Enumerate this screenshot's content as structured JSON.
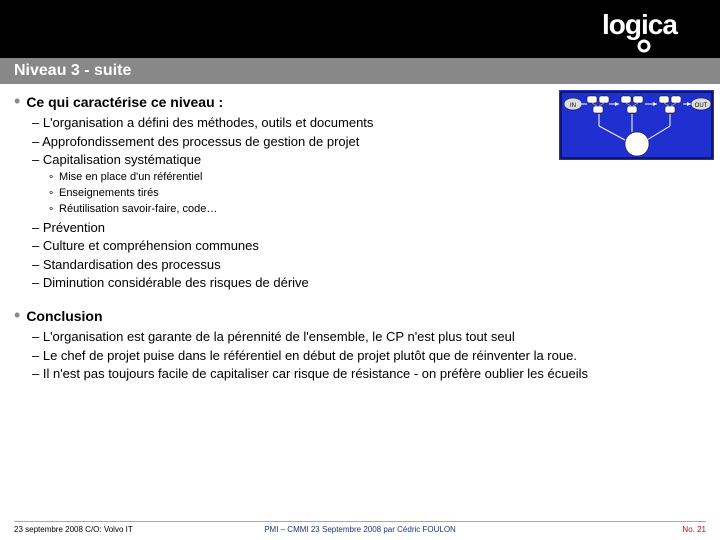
{
  "logo": {
    "name": "logica"
  },
  "title": "Niveau 3 - suite",
  "sections": [
    {
      "heading": "Ce qui caractérise ce niveau :",
      "items": [
        {
          "text": "L'organisation a défini des méthodes, outils et documents"
        },
        {
          "text": "Approfondissement des processus de gestion de projet"
        },
        {
          "text": "Capitalisation systématique",
          "sub": [
            "Mise en place d'un référentiel",
            "Enseignements tirés",
            "Réutilisation savoir-faire, code…"
          ]
        },
        {
          "text": "Prévention"
        },
        {
          "text": "Culture et compréhension communes"
        },
        {
          "text": "Standardisation des processus"
        },
        {
          "text": "Diminution considérable des risques de dérive"
        }
      ]
    },
    {
      "heading": "Conclusion",
      "items": [
        {
          "text": "L'organisation est garante de la pérennité de l'ensemble, le CP n'est plus tout seul"
        },
        {
          "text": "Le chef de projet puise dans le référentiel en début de projet plutôt que de réinventer la roue."
        },
        {
          "text": "Il n'est pas toujours facile de capitaliser car risque de résistance - on préfère oublier les écueils"
        }
      ]
    }
  ],
  "diagram": {
    "in": "IN",
    "out": "OUT"
  },
  "footer": {
    "left": "23 septembre 2008  C/O: Volvo IT",
    "mid": "PMI – CMMI 23 Septembre 2008 par Cédric FOULON",
    "right": "No. 21"
  }
}
